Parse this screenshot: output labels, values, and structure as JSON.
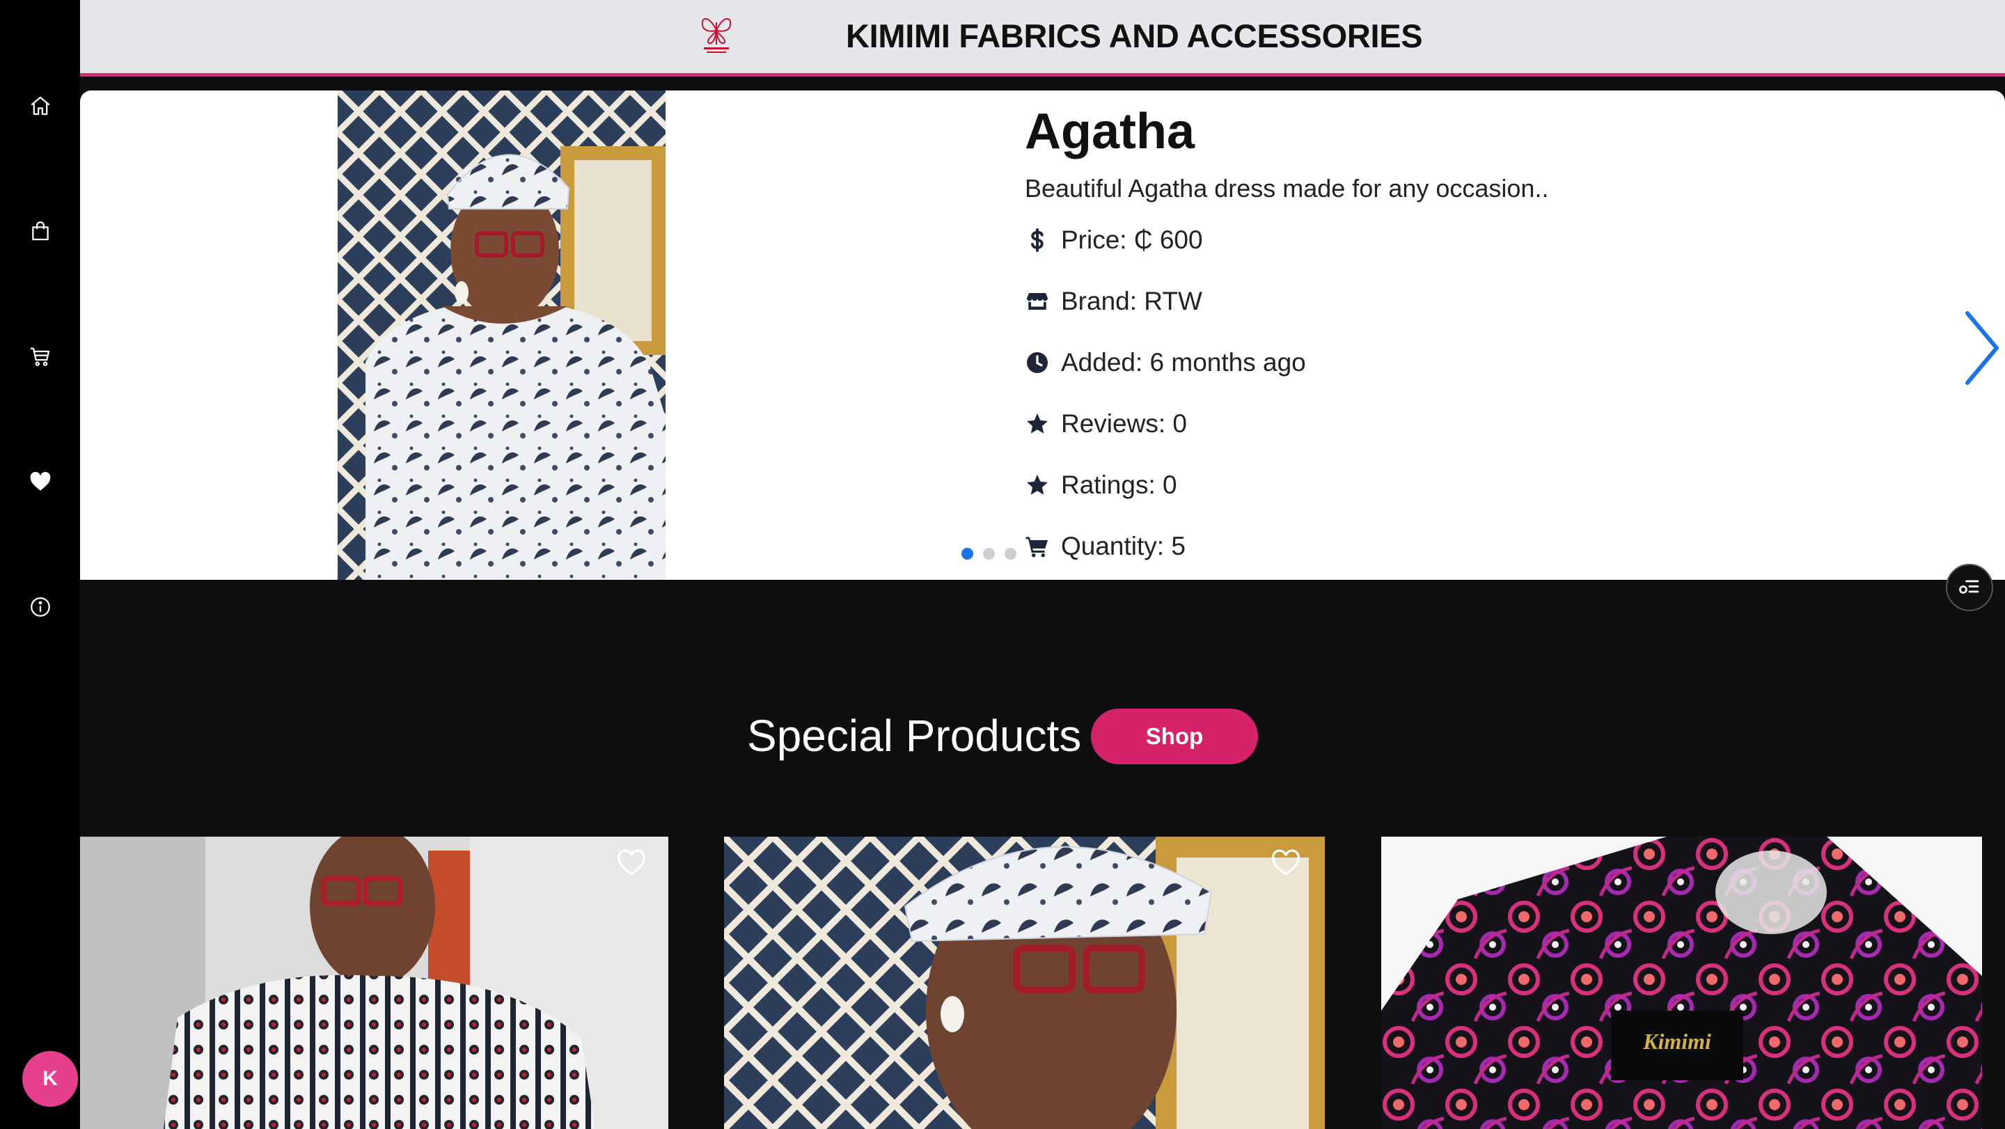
{
  "header": {
    "brand": "KIMIMI FABRICS AND ACCESSORIES",
    "logo_icon": "butterfly-logo-icon",
    "accent_color": "#e0287a"
  },
  "sidebar": {
    "items": [
      {
        "icon": "home-icon"
      },
      {
        "icon": "shopping-bag-icon"
      },
      {
        "icon": "cart-icon"
      },
      {
        "icon": "heart-icon"
      },
      {
        "icon": "info-icon"
      }
    ],
    "avatar_initial": "K",
    "avatar_color": "#e63f8d"
  },
  "carousel": {
    "title": "Agatha",
    "description": "Beautiful Agatha dress made for any occasion..",
    "price": "Price: ₵ 600",
    "brand": "Brand: RTW",
    "added": "Added: 6 months ago",
    "reviews": "Reviews: 0",
    "ratings": "Ratings: 0",
    "quantity": "Quantity: 5",
    "slide_count": 3,
    "active_slide": 1
  },
  "special": {
    "title": "Special Products",
    "shop_label": "Shop",
    "shop_color": "#d6226b"
  },
  "products": [
    {
      "favorite_icon": "heart-outline-icon"
    },
    {
      "favorite_icon": "heart-outline-icon"
    },
    {
      "favorite_icon": "none"
    }
  ]
}
